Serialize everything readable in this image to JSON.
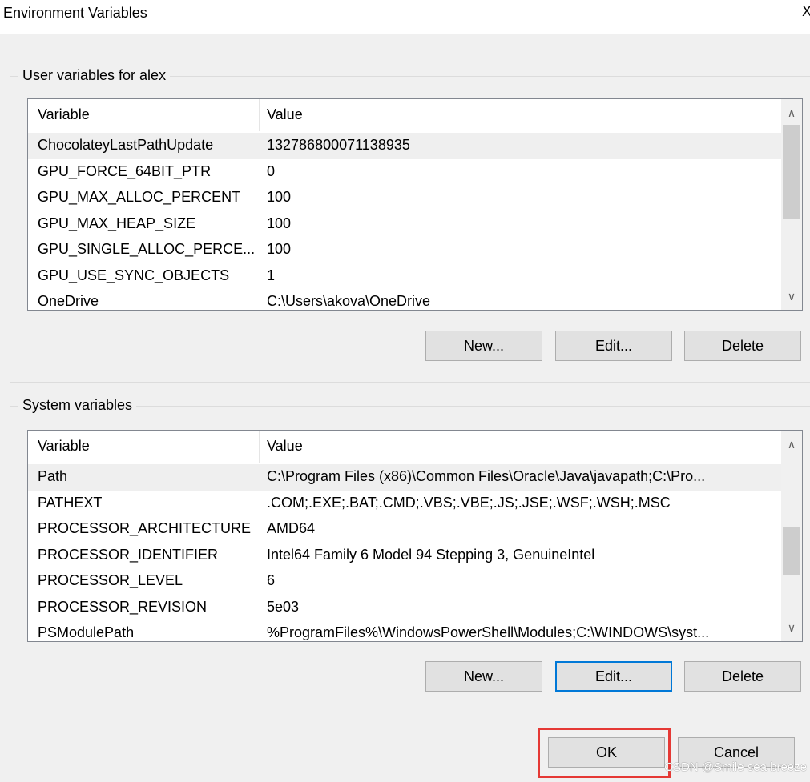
{
  "window": {
    "title": "Environment Variables",
    "close_glyph": "X"
  },
  "user_vars": {
    "label": "User variables for alex",
    "columns": [
      "Variable",
      "Value"
    ],
    "rows": [
      {
        "name": "ChocolateyLastPathUpdate",
        "value": "132786800071138935",
        "selected": true
      },
      {
        "name": "GPU_FORCE_64BIT_PTR",
        "value": "0"
      },
      {
        "name": "GPU_MAX_ALLOC_PERCENT",
        "value": "100"
      },
      {
        "name": "GPU_MAX_HEAP_SIZE",
        "value": "100"
      },
      {
        "name": "GPU_SINGLE_ALLOC_PERCE...",
        "value": "100"
      },
      {
        "name": "GPU_USE_SYNC_OBJECTS",
        "value": "1"
      },
      {
        "name": "OneDrive",
        "value": "C:\\Users\\akova\\OneDrive"
      }
    ],
    "buttons": {
      "new": "New...",
      "edit": "Edit...",
      "delete": "Delete"
    }
  },
  "system_vars": {
    "label": "System variables",
    "columns": [
      "Variable",
      "Value"
    ],
    "rows": [
      {
        "name": "Path",
        "value": "C:\\Program Files (x86)\\Common Files\\Oracle\\Java\\javapath;C:\\Pro...",
        "selected": true
      },
      {
        "name": "PATHEXT",
        "value": ".COM;.EXE;.BAT;.CMD;.VBS;.VBE;.JS;.JSE;.WSF;.WSH;.MSC"
      },
      {
        "name": "PROCESSOR_ARCHITECTURE",
        "value": "AMD64"
      },
      {
        "name": "PROCESSOR_IDENTIFIER",
        "value": "Intel64 Family 6 Model 94 Stepping 3, GenuineIntel"
      },
      {
        "name": "PROCESSOR_LEVEL",
        "value": "6"
      },
      {
        "name": "PROCESSOR_REVISION",
        "value": "5e03"
      },
      {
        "name": "PSModulePath",
        "value": "%ProgramFiles%\\WindowsPowerShell\\Modules;C:\\WINDOWS\\syst..."
      }
    ],
    "buttons": {
      "new": "New...",
      "edit": "Edit...",
      "delete": "Delete"
    }
  },
  "footer": {
    "ok": "OK",
    "cancel": "Cancel"
  },
  "watermark": "CSDN @Smile sea breeze",
  "colors": {
    "focus_border": "#0078d7",
    "highlight": "#e53935",
    "selected_row": "#efefef"
  }
}
